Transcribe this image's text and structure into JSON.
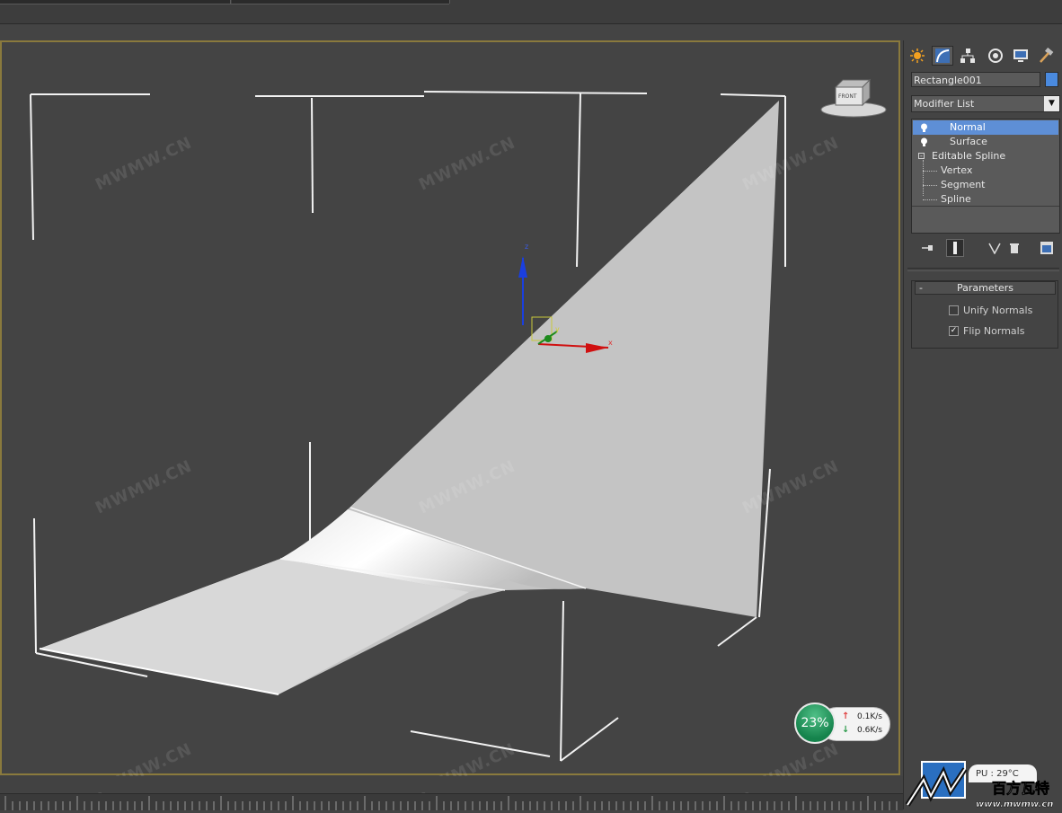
{
  "viewport": {
    "watermarks": [
      "MWMW.CN",
      "MWMW.CN",
      "MWMW.CN",
      "MWMW.CN",
      "MWMW.CN",
      "MWMW.CN",
      "MWMW.CN",
      "MWMW.CN",
      "MWMW.CN"
    ],
    "viewcube_label": "FRONT",
    "gizmo": {
      "x_label": "x",
      "y_label": "y",
      "z_label": "z"
    },
    "accent_border": "#8a7a3d",
    "surface_color": "#c4c4c4"
  },
  "panel": {
    "tabs": [
      {
        "name": "create-tab",
        "icon": "sun-icon"
      },
      {
        "name": "modify-tab",
        "icon": "curve-icon"
      },
      {
        "name": "hierarchy-tab",
        "icon": "hierarchy-icon"
      },
      {
        "name": "motion-tab",
        "icon": "motion-icon"
      },
      {
        "name": "display-tab",
        "icon": "monitor-icon"
      },
      {
        "name": "utilities-tab",
        "icon": "hammer-icon"
      }
    ],
    "object_name": "Rectangle001",
    "object_color": "#4a8adf",
    "modifier_list": "Modifier List",
    "stack": {
      "normal": "Normal",
      "surface": "Surface",
      "editable_spline": "Editable Spline",
      "vertex": "Vertex",
      "segment": "Segment",
      "spline": "Spline"
    },
    "parameters": {
      "title": "Parameters",
      "collapse": "-",
      "unify_normals": "Unify Normals",
      "unify_checked": false,
      "flip_normals": "Flip Normals",
      "flip_checked": true
    }
  },
  "network": {
    "percent": "23%",
    "up": "0.1K/s",
    "down": "0.6K/s"
  },
  "status": {
    "cpu": "PU : 29°C",
    "logo_text": "百方瓦特",
    "logo_url": "www.mwmw.cn"
  }
}
